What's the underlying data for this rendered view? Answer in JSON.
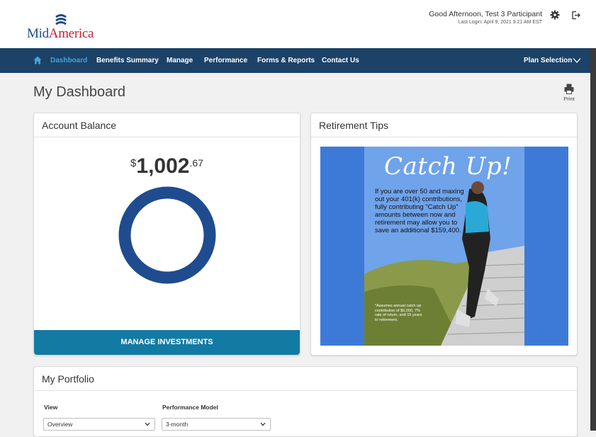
{
  "brand": {
    "logo_part1": "Mid",
    "logo_part2": "America"
  },
  "header": {
    "greeting": "Good Afternoon,  Test 3 Participant",
    "last_login": "Last Login: April 9, 2021 9:21 AM EST"
  },
  "nav": {
    "items": [
      {
        "label": "Dashboard",
        "active": true
      },
      {
        "label": "Benefits Summary"
      },
      {
        "label": "Manage"
      },
      {
        "label": "Performance"
      },
      {
        "label": "Forms & Reports"
      },
      {
        "label": "Contact Us"
      }
    ],
    "plan_selection": "Plan Selection"
  },
  "page": {
    "title": "My Dashboard",
    "print_label": "Print"
  },
  "account_balance": {
    "title": "Account Balance",
    "currency": "$",
    "whole": "1,002",
    "cents": ".67",
    "button": "MANAGE INVESTMENTS"
  },
  "retirement_tips": {
    "title": "Retirement Tips",
    "heading": "Catch Up!",
    "body": "If you are over 50 and maxing out your 401(k) contributions, fully contributing \"Catch Up\" amounts between now and retirement may allow you to save an additional $159,400.",
    "footnote": "*Assumes annual catch up contribution of $6,000, 7% rate of return, and 15 years to retirement."
  },
  "portfolio": {
    "title": "My Portfolio",
    "view_label": "View",
    "view_value": "Overview",
    "model_label": "Performance Model",
    "model_value": "3-month"
  },
  "colors": {
    "nav": "#1c4268",
    "accent": "#137aa3",
    "donut": "#1f4c8f"
  }
}
